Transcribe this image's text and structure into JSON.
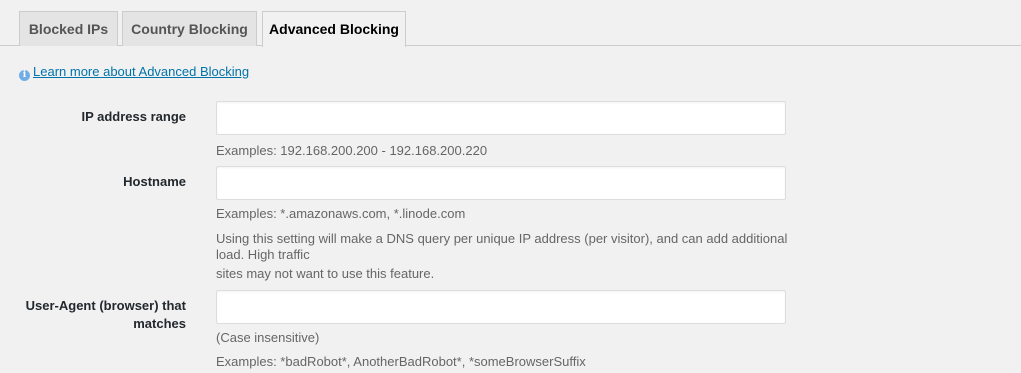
{
  "tabs": [
    {
      "label": "Blocked IPs"
    },
    {
      "label": "Country Blocking"
    },
    {
      "label": "Advanced Blocking"
    }
  ],
  "learn_more": "Learn more about Advanced Blocking",
  "fields": {
    "ip_range": {
      "label": "IP address range",
      "value": "",
      "example": "Examples: 192.168.200.200 - 192.168.200.220"
    },
    "hostname": {
      "label": "Hostname",
      "value": "",
      "example": "Examples: *.amazonaws.com, *.linode.com",
      "note_line1": "Using this setting will make a DNS query per unique IP address (per visitor), and can add additional",
      "note_line2": "load. High traffic",
      "note_line3": "sites may not want to use this feature."
    },
    "user_agent": {
      "label_line1": "User-Agent (browser) that",
      "label_line2": "matches",
      "value": "",
      "case_note": "(Case insensitive)",
      "example": "Examples: *badRobot*, AnotherBadRobot*, *someBrowserSuffix"
    }
  }
}
